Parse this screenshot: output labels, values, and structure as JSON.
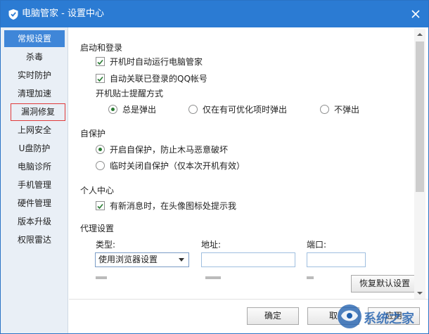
{
  "window": {
    "title": "电脑管家 - 设置中心"
  },
  "sidebar": {
    "items": [
      {
        "label": "常规设置"
      },
      {
        "label": "杀毒"
      },
      {
        "label": "实时防护"
      },
      {
        "label": "清理加速"
      },
      {
        "label": "漏洞修复"
      },
      {
        "label": "上网安全"
      },
      {
        "label": "U盘防护"
      },
      {
        "label": "电脑诊所"
      },
      {
        "label": "手机管理"
      },
      {
        "label": "硬件管理"
      },
      {
        "label": "版本升级"
      },
      {
        "label": "权限雷达"
      }
    ],
    "active_index": 0,
    "highlighted_index": 4
  },
  "startup": {
    "heading": "启动和登录",
    "auto_run": "开机时自动运行电脑管家",
    "auto_link_qq": "自动关联已登录的QQ帐号",
    "tip_heading": "开机贴士提醒方式",
    "tip_options": [
      "总是弹出",
      "仅在有可优化项时弹出",
      "不弹出"
    ],
    "tip_selected": 0
  },
  "self_protect": {
    "heading": "自保护",
    "options": [
      "开启自保护，防止木马恶意破坏",
      "临时关闭自保护（仅本次开机有效）"
    ],
    "selected": 0
  },
  "personal": {
    "heading": "个人中心",
    "notify": "有新消息时，在头像图标处提示我"
  },
  "proxy": {
    "heading": "代理设置",
    "type_label": "类型:",
    "type_value": "使用浏览器设置",
    "address_label": "地址:",
    "address_value": "",
    "port_label": "端口:",
    "port_value": ""
  },
  "buttons": {
    "restore_defaults": "恢复默认设置",
    "ok": "确定",
    "cancel": "取",
    "apply": "应用"
  },
  "watermark": {
    "text": "系统之家"
  },
  "colors": {
    "titlebar": "#2b7bd3",
    "sidebar_active": "#3f86d8",
    "highlight_border": "#e03a3a",
    "check": "#2a7b33"
  }
}
